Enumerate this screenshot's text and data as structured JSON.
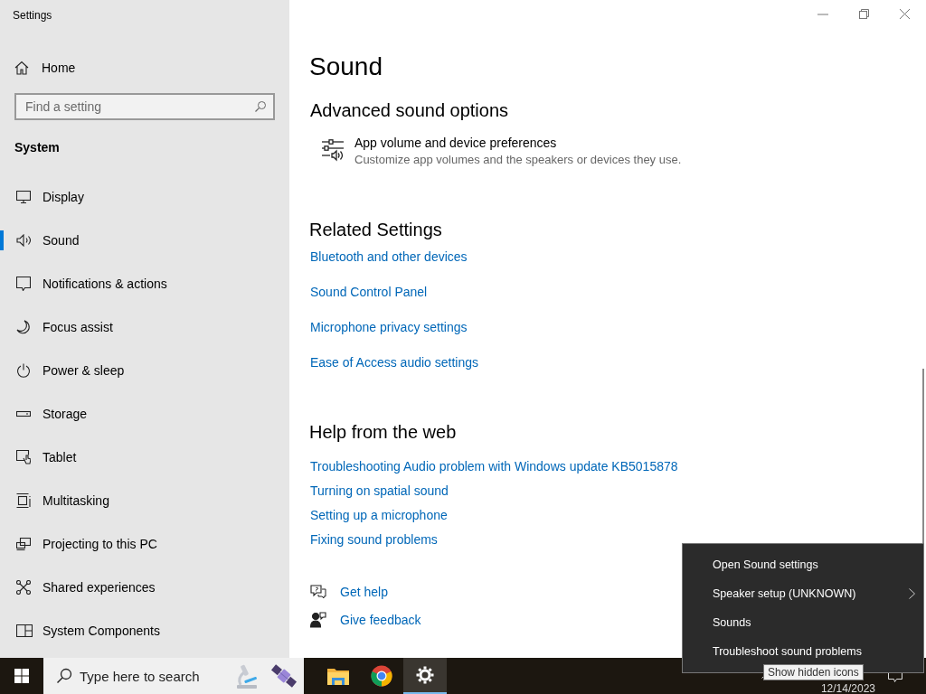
{
  "window": {
    "title": "Settings"
  },
  "sidebar": {
    "home": "Home",
    "search": {
      "placeholder": "Find a setting"
    },
    "section": "System",
    "items": [
      {
        "label": "Display",
        "selected": false
      },
      {
        "label": "Sound",
        "selected": true
      },
      {
        "label": "Notifications & actions",
        "selected": false
      },
      {
        "label": "Focus assist",
        "selected": false
      },
      {
        "label": "Power & sleep",
        "selected": false
      },
      {
        "label": "Storage",
        "selected": false
      },
      {
        "label": "Tablet",
        "selected": false
      },
      {
        "label": "Multitasking",
        "selected": false
      },
      {
        "label": "Projecting to this PC",
        "selected": false
      },
      {
        "label": "Shared experiences",
        "selected": false
      },
      {
        "label": "System Components",
        "selected": false
      }
    ]
  },
  "main": {
    "title": "Sound",
    "advanced": {
      "heading": "Advanced sound options",
      "item": {
        "title": "App volume and device preferences",
        "description": "Customize app volumes and the speakers or devices they use."
      }
    },
    "related": {
      "heading": "Related Settings",
      "links": [
        "Bluetooth and other devices",
        "Sound Control Panel",
        "Microphone privacy settings",
        "Ease of Access audio settings"
      ]
    },
    "help": {
      "heading": "Help from the web",
      "links": [
        "Troubleshooting Audio problem with Windows update KB5015878",
        "Turning on spatial sound",
        "Setting up a microphone",
        "Fixing sound problems"
      ]
    },
    "actions": [
      "Get help",
      "Give feedback"
    ]
  },
  "context_menu": {
    "items": [
      {
        "label": "Open Sound settings",
        "submenu": false
      },
      {
        "label": "Speaker setup (UNKNOWN)",
        "submenu": true
      },
      {
        "label": "Sounds",
        "submenu": false
      },
      {
        "label": "Troubleshoot sound problems",
        "submenu": false
      }
    ]
  },
  "tooltip": "Show hidden icons",
  "taskbar": {
    "search": {
      "placeholder": "Type here to search"
    },
    "apps": [
      {
        "selected": false
      },
      {
        "selected": false
      },
      {
        "selected": true
      }
    ],
    "date": "12/14/2023"
  }
}
